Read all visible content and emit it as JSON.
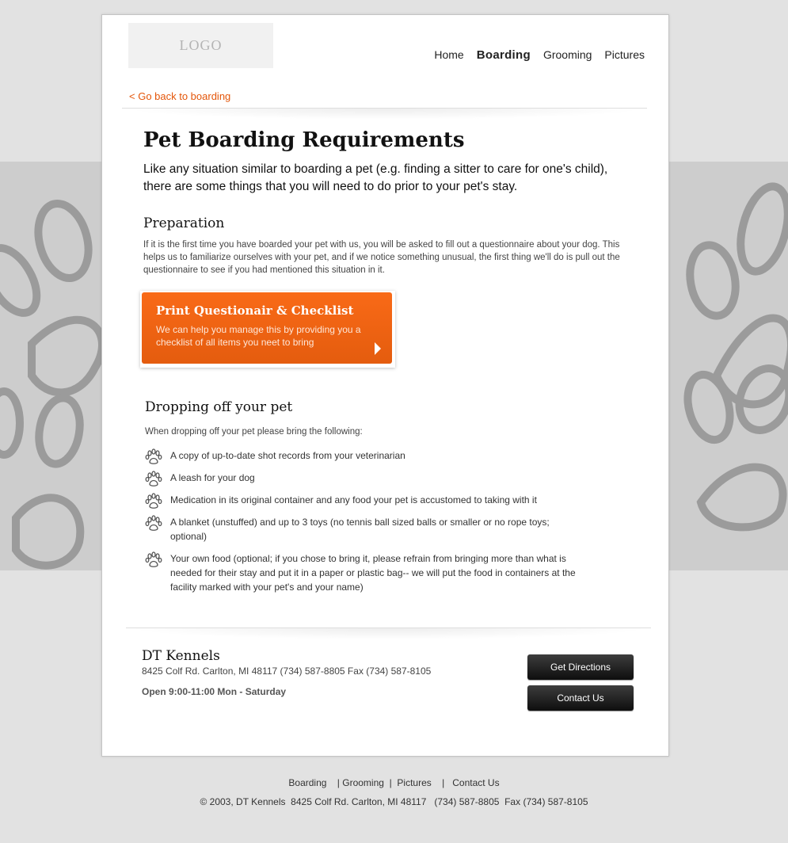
{
  "header": {
    "logo": "LOGO",
    "nav": [
      "Home",
      "Boarding",
      "Grooming",
      "Pictures"
    ],
    "active": "Boarding"
  },
  "back_link": "< Go back to boarding",
  "main": {
    "title": "Pet Boarding Requirements",
    "intro": "Like any situation similar to boarding a pet (e.g. finding a sitter to care for one's child), there are some things that you will need to do prior to your pet's stay.",
    "preparation": {
      "heading": "Preparation",
      "body": "If it is the first time you have boarded your pet with us, you will be asked to fill out a questionnaire about your dog. This helps us to familiarize ourselves with your pet, and if we notice something unusual, the first thing we'll do is pull out the questionnaire to see if you had mentioned this situation in it."
    },
    "cta": {
      "title": "Print Questionair & Checklist",
      "description": "We can help you manage this by providing you a checklist of all items you neet to bring"
    },
    "dropoff": {
      "heading": "Dropping off your pet",
      "lead": "When dropping off your pet please bring the following:",
      "items": [
        "A copy of up-to-date shot records from your veterinarian",
        "A leash for your dog",
        "Medication in its original container and any food your pet is accustomed to taking with it",
        "A blanket (unstuffed) and up to 3 toys (no tennis ball sized balls or smaller or no rope toys; optional)",
        "Your own food (optional; if you chose to bring it, please refrain from bringing more than what is needed for their stay and put it in a paper or plastic bag-- we will put the food in containers at the facility marked with your pet's and your name)"
      ]
    }
  },
  "footer": {
    "name": "DT Kennels",
    "address": "8425 Colf Rd. Carlton, MI 48117  (734) 587-8805  Fax (734) 587-8105",
    "hours": "Open 9:00-11:00 Mon - Saturday",
    "directions_btn": "Get Directions",
    "contact_btn": "Contact Us"
  },
  "bottom": {
    "links": [
      "Boarding",
      "Grooming",
      "Pictures",
      "Contact Us"
    ],
    "copyright": "© 2003, DT Kennels  8425 Colf Rd. Carlton, MI 48117   (734) 587-8805  Fax (734) 587-8105"
  },
  "colors": {
    "accent": "#e4560a",
    "cta_top": "#f96a17",
    "band": "#cdcdcd",
    "background": "#e2e2e2"
  },
  "icons": {
    "list_bullet": "paw-icon",
    "background_pattern": "paw-print-pattern"
  }
}
